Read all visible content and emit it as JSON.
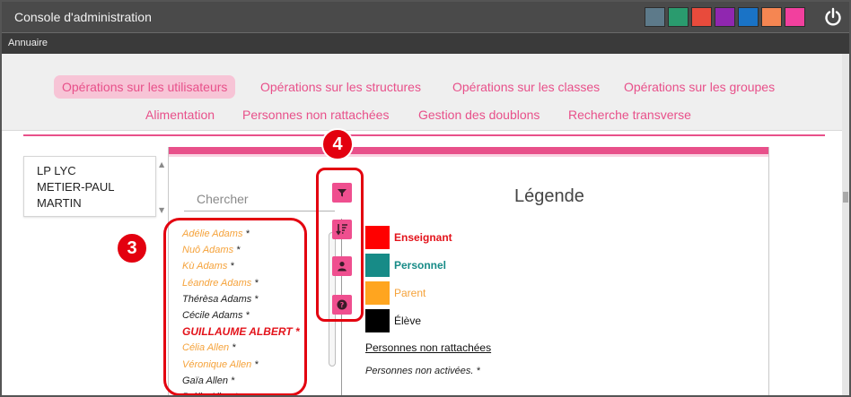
{
  "app": {
    "title": "Console d'administration",
    "subbar_label": "Annuaire"
  },
  "theme_colors": [
    "#5d7a8a",
    "#2a9b6e",
    "#e84b3c",
    "#9027b0",
    "#1a73c6",
    "#f58652",
    "#f2409e"
  ],
  "tabs_row1": [
    {
      "label": "Opérations sur les utilisateurs",
      "active": true
    },
    {
      "label": "Opérations sur les structures",
      "active": false
    },
    {
      "label": "Opérations sur les classes",
      "active": false
    },
    {
      "label": "Opérations sur les groupes",
      "active": false
    }
  ],
  "tabs_row2": [
    {
      "label": "Alimentation"
    },
    {
      "label": "Personnes non rattachées"
    },
    {
      "label": "Gestion des doublons"
    },
    {
      "label": "Recherche transverse"
    }
  ],
  "structure": {
    "lines": [
      "LP LYC",
      "METIER-PAUL",
      "MARTIN"
    ]
  },
  "search": {
    "placeholder": "Chercher"
  },
  "users": [
    {
      "name": "Adélie Adams",
      "suffix": " *",
      "color": "#f5a23a",
      "bold": false
    },
    {
      "name": "Nuô Adams",
      "suffix": " *",
      "color": "#f5a23a",
      "bold": false
    },
    {
      "name": "Kù Adams",
      "suffix": " *",
      "color": "#f5a23a",
      "bold": false
    },
    {
      "name": "Léandre Adams",
      "suffix": " *",
      "color": "#f5a23a",
      "bold": false
    },
    {
      "name": "Thérèsa Adams",
      "suffix": " *",
      "color": "#222222",
      "bold": false
    },
    {
      "name": "Cécile Adams",
      "suffix": " *",
      "color": "#222222",
      "bold": false
    },
    {
      "name": "GUILLAUME ALBERT",
      "suffix": " *",
      "color": "#e3131b",
      "bold": true
    },
    {
      "name": "Célia Allen",
      "suffix": " *",
      "color": "#f5a23a",
      "bold": false
    },
    {
      "name": "Véronique Allen",
      "suffix": " *",
      "color": "#f5a23a",
      "bold": false
    },
    {
      "name": "Gaïa Allen",
      "suffix": " *",
      "color": "#222222",
      "bold": false
    },
    {
      "name": "Prélia Allen",
      "suffix": " *",
      "color": "#222222",
      "bold": false
    }
  ],
  "tools": [
    {
      "icon": "filter-icon"
    },
    {
      "icon": "sort-icon"
    },
    {
      "icon": "user-icon"
    },
    {
      "icon": "help-icon"
    }
  ],
  "legend": {
    "title": "Légende",
    "items": [
      {
        "label": "Enseignant",
        "color": "#ff0000",
        "text_color": "#e3131b",
        "bold": true
      },
      {
        "label": "Personnel",
        "color": "#178b87",
        "text_color": "#178b87",
        "bold": true
      },
      {
        "label": "Parent",
        "color": "#ffa51f",
        "text_color": "#f5a23a",
        "bold": false
      },
      {
        "label": "Élève",
        "color": "#000000",
        "text_color": "#111111",
        "bold": false
      }
    ],
    "link": "Personnes non rattachées",
    "note": "Personnes non activées. *"
  },
  "callouts": {
    "list": "3",
    "toolbar": "4"
  }
}
